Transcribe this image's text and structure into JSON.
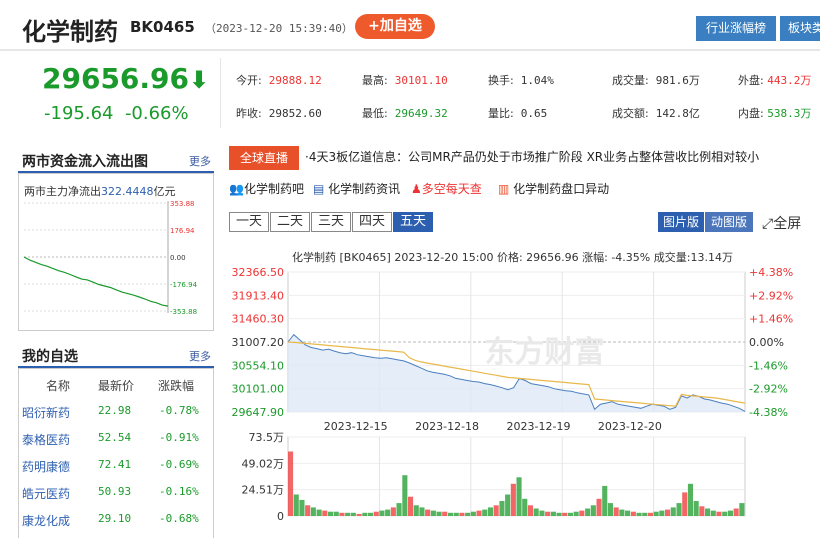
{
  "header": {
    "title": "化学制药",
    "code": "BK0465",
    "timestamp": "（2023-12-20 15:39:40）",
    "add_watch": "+加自选",
    "btn_industry": "行业涨幅榜",
    "btn_block": "板块类"
  },
  "quote": {
    "price": "29656.96",
    "arrow": "⬇",
    "change": "-195.64",
    "change_pct": "-0.66%",
    "open_label": "今开:",
    "open": "29888.12",
    "high_label": "最高:",
    "high": "30101.10",
    "turnover_label": "换手:",
    "turnover": "1.04%",
    "volume_label": "成交量:",
    "volume": "981.6万",
    "outer_label": "外盘:",
    "outer": "443.2万",
    "prev_label": "昨收:",
    "prev": "29852.60",
    "low_label": "最低:",
    "low": "29649.32",
    "ratio_label": "量比:",
    "ratio": "0.65",
    "amount_label": "成交额:",
    "amount": "142.8亿",
    "inner_label": "内盘:",
    "inner": "538.3万"
  },
  "capital_flow": {
    "title": "两市资金流入流出图",
    "more": "更多",
    "net_label": "两市主力净流出",
    "net_value": "322.4448",
    "net_unit": "亿元",
    "ticks": [
      "353.88",
      "176.94",
      "0.00",
      "-176.94",
      "-353.88"
    ],
    "flow_series": [
      0,
      -20,
      -35,
      -50,
      -60,
      -75,
      -90,
      -100,
      -115,
      -130,
      -145,
      -150,
      -165,
      -180,
      -190,
      -200,
      -215,
      -230,
      -240,
      -250,
      -262,
      -275,
      -290,
      -300,
      -315,
      -322
    ]
  },
  "watchlist": {
    "title": "我的自选",
    "more": "更多",
    "col_name": "名称",
    "col_price": "最新价",
    "col_chg": "涨跌幅",
    "rows": [
      {
        "name": "昭衍新药",
        "price": "22.98",
        "chg": "-0.78%"
      },
      {
        "name": "泰格医药",
        "price": "52.54",
        "chg": "-0.91%"
      },
      {
        "name": "药明康德",
        "price": "72.41",
        "chg": "-0.69%"
      },
      {
        "name": "皓元医药",
        "price": "50.93",
        "chg": "-0.16%"
      },
      {
        "name": "康龙化成",
        "price": "29.10",
        "chg": "-0.68%"
      }
    ]
  },
  "ticker": {
    "label": "全球直播",
    "text": "·4天3板亿道信息：公司MR产品仍处于市场推广阶段 XR业务占整体营收比例相对较小"
  },
  "links": {
    "bar": "化学制药吧",
    "news": "化学制药资讯",
    "daily": "多空每天查",
    "alert": "化学制药盘口异动"
  },
  "chart_tabs": {
    "tabs": [
      "一天",
      "二天",
      "三天",
      "四天",
      "五天"
    ],
    "active": "五天",
    "pic": "图片版",
    "dyn": "动图版",
    "fullscreen": "全屏"
  },
  "chart_data": {
    "type": "line",
    "title": "化学制药 [BK0465]  2023-12-20 15:00  价格: 29656.96  涨幅: -4.35%  成交量:13.14万",
    "y_ticks_left": [
      "32366.50",
      "31913.40",
      "31460.30",
      "31007.20",
      "30554.10",
      "30101.00",
      "29647.90"
    ],
    "y_ticks_right": [
      "+4.38%",
      "+2.92%",
      "+1.46%",
      "0.00%",
      "-1.46%",
      "-2.92%",
      "-4.38%"
    ],
    "ylim": [
      29647.9,
      32366.5
    ],
    "x_labels": [
      "2023-12-15",
      "2023-12-18",
      "2023-12-19",
      "2023-12-20"
    ],
    "watermark": "东方财富",
    "series": [
      {
        "values": [
          31007,
          31150,
          31050,
          30950,
          30900,
          30880,
          30850,
          30870,
          30830,
          30800,
          30780,
          30800,
          30760,
          30740,
          30720,
          30700,
          30690,
          30700,
          30680,
          30660,
          30640,
          30600,
          30550,
          30500,
          30450,
          30420,
          30400,
          30380,
          30350,
          30300,
          30280,
          30260,
          30240,
          30230,
          30200,
          30180,
          30150,
          30120,
          30080,
          30120,
          30300,
          30260,
          30200,
          30180,
          30160,
          30140,
          30100,
          30080,
          30060,
          30050,
          30020,
          30000,
          29980,
          29700,
          29800,
          29820,
          29850,
          29800,
          29780,
          29760,
          29740,
          29720,
          29760,
          29800,
          29780,
          29760,
          29700,
          29740,
          29960,
          29920,
          29980,
          29950,
          29900,
          29880,
          29850,
          29820,
          29800,
          29760,
          29720,
          29660
        ]
      },
      {
        "values": [
          31007,
          31000,
          30990,
          30980,
          30970,
          30960,
          30950,
          30940,
          30930,
          30920,
          30910,
          30900,
          30890,
          30880,
          30870,
          30860,
          30850,
          30840,
          30830,
          30820,
          30810,
          30700,
          30650,
          30620,
          30600,
          30580,
          30560,
          30540,
          30520,
          30500,
          30480,
          30460,
          30440,
          30420,
          30400,
          30380,
          30360,
          30340,
          30320,
          30310,
          30300,
          30290,
          30280,
          30270,
          30260,
          30250,
          30240,
          30230,
          30220,
          30210,
          30200,
          30190,
          30180,
          29900,
          29890,
          29880,
          29870,
          29860,
          29850,
          29840,
          29830,
          29820,
          29810,
          29800,
          29790,
          29780,
          29770,
          29760,
          29990,
          29970,
          29960,
          29950,
          29940,
          29930,
          29920,
          29900,
          29880,
          29860,
          29840,
          29820
        ]
      }
    ],
    "volume": {
      "y_ticks": [
        "73.5万",
        "49.02万",
        "24.51万",
        "0"
      ],
      "ylim": [
        0,
        73.5
      ],
      "values": [
        60,
        20,
        15,
        10,
        8,
        6,
        5,
        4,
        4,
        3,
        3,
        3,
        2,
        3,
        3,
        4,
        5,
        6,
        8,
        12,
        38,
        18,
        10,
        8,
        6,
        5,
        4,
        4,
        3,
        3,
        3,
        3,
        4,
        5,
        6,
        8,
        10,
        14,
        20,
        30,
        36,
        16,
        10,
        7,
        5,
        4,
        4,
        3,
        3,
        3,
        4,
        5,
        7,
        10,
        16,
        28,
        12,
        8,
        6,
        5,
        4,
        3,
        3,
        3,
        4,
        5,
        6,
        8,
        12,
        22,
        30,
        14,
        9,
        7,
        5,
        4,
        4,
        5,
        7,
        12
      ]
    }
  }
}
